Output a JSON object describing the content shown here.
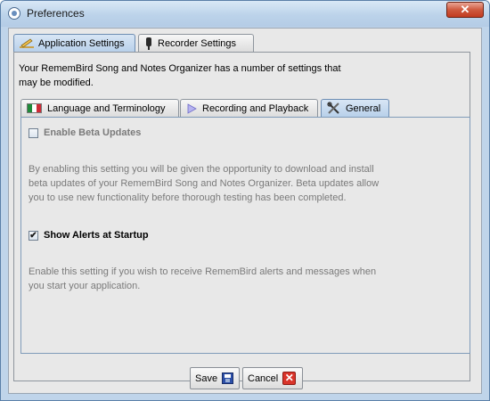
{
  "window": {
    "title": "Preferences",
    "close_glyph": "✕"
  },
  "top_tabs": [
    {
      "label": "Application Settings",
      "icon": "pen-icon",
      "active": true
    },
    {
      "label": "Recorder Settings",
      "icon": "microphone-icon",
      "active": false
    }
  ],
  "description": "Your RememBird Song and Notes Organizer has a number of settings that may be modified.",
  "sub_tabs": [
    {
      "label": "Language and Terminology",
      "icon": "italy-flag-icon",
      "active": false
    },
    {
      "label": "Recording and Playback",
      "icon": "play-icon",
      "active": false
    },
    {
      "label": "General",
      "icon": "tools-icon",
      "active": true
    }
  ],
  "general": {
    "beta": {
      "label": "Enable Beta Updates",
      "checked": false,
      "help": "By enabling this setting you will be given the opportunity to download and install beta updates of your RememBird Song and Notes Organizer. Beta updates allow you to use new functionality before thorough testing has been completed."
    },
    "alerts": {
      "label": "Show Alerts at Startup",
      "checked": true,
      "check_glyph": "✔",
      "help": "Enable this setting if you wish to receive RememBird alerts and messages when you start your application."
    }
  },
  "buttons": {
    "save": "Save",
    "cancel": "Cancel",
    "cancel_glyph": "✕"
  },
  "colors": {
    "titlebar": "#bcd3ea",
    "panel": "#e8e8e8",
    "active_tab": "#b8d0ea",
    "close_red": "#c13a1f"
  }
}
